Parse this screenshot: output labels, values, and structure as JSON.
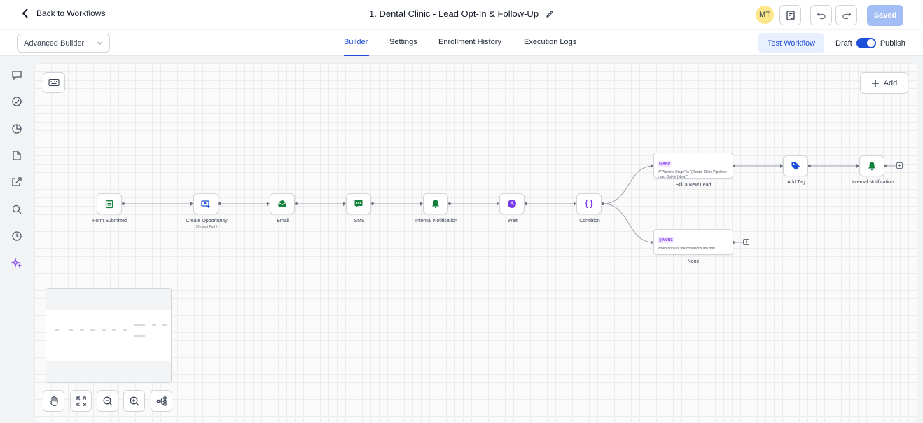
{
  "header": {
    "back_label": "Back to Workflows",
    "title": "1. Dental Clinic - Lead Opt-In & Follow-Up",
    "avatar_initials": "MT",
    "saved_label": "Saved"
  },
  "subbar": {
    "builder_mode": "Advanced Builder",
    "tabs": [
      {
        "label": "Builder",
        "active": true
      },
      {
        "label": "Settings",
        "active": false
      },
      {
        "label": "Enrollment History",
        "active": false
      },
      {
        "label": "Execution Logs",
        "active": false
      }
    ],
    "test_label": "Test Workflow",
    "draft_label": "Draft",
    "publish_label": "Publish"
  },
  "canvas": {
    "add_label": "Add",
    "nodes": [
      {
        "label": "Form Submitted",
        "icon": "clipboard-icon",
        "color": "#15803d"
      },
      {
        "label": "Create Opportunity",
        "sublabel": "(Default Path)",
        "icon": "opportunity-icon",
        "color": "#1d4ed8"
      },
      {
        "label": "Email",
        "icon": "email-icon",
        "color": "#15803d"
      },
      {
        "label": "SMS",
        "icon": "sms-icon",
        "color": "#15803d"
      },
      {
        "label": "Internal Notification",
        "icon": "bell-icon",
        "color": "#15803d"
      },
      {
        "label": "Wait",
        "icon": "clock-icon",
        "color": "#7c3aed"
      },
      {
        "label": "Condition",
        "icon": "braces-icon",
        "color": "#7c3aed"
      }
    ],
    "branches": [
      {
        "tag": "{} AND",
        "text": "If \"Pipeline Stage\" is \"(Dental Clinic Pipeline) - Lead Opt-In (New)\"",
        "label": "Still a New Lead"
      },
      {
        "tag": "{} NONE",
        "text": "When none of the conditions are met",
        "label": "None"
      }
    ],
    "branch_nodes": [
      {
        "label": "Add Tag",
        "icon": "tag-icon",
        "color": "#1d4ed8"
      },
      {
        "label": "Internal Notification",
        "icon": "bell-icon",
        "color": "#15803d"
      }
    ]
  }
}
